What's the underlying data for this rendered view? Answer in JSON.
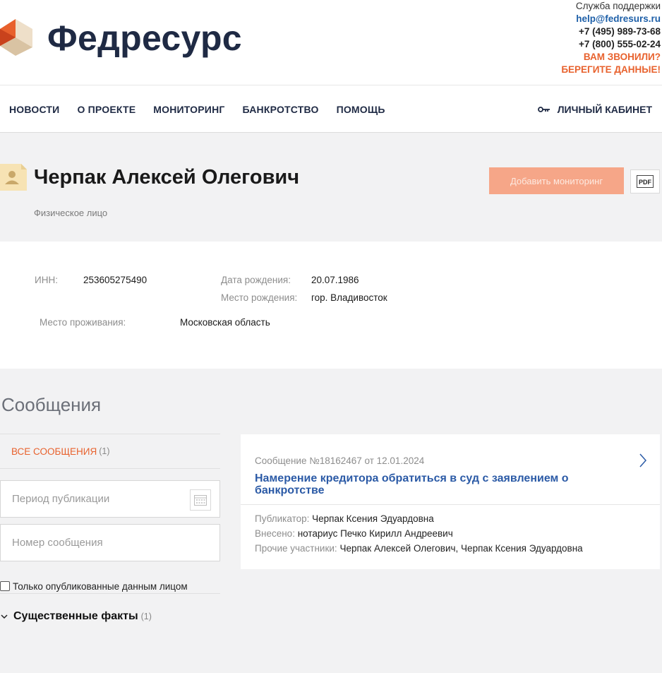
{
  "header": {
    "brand": "Федресурс",
    "support_label": "Служба поддержки",
    "support_email": "help@fedresurs.ru",
    "phone_1": "+7 (495) 989-73-68",
    "phone_2": "+7 (800) 555-02-24",
    "warning_1": "ВАМ ЗВОНИЛИ?",
    "warning_2": "БЕРЕГИТЕ ДАННЫЕ!"
  },
  "nav": {
    "items": [
      "НОВОСТИ",
      "О ПРОЕКТЕ",
      "МОНИТОРИНГ",
      "БАНКРОТСТВО",
      "ПОМОЩЬ"
    ],
    "cabinet": "ЛИЧНЫЙ КАБИНЕТ"
  },
  "person": {
    "name": "Черпак Алексей Олегович",
    "type": "Физическое лицо",
    "monitor_button": "Добавить мониторинг",
    "pdf_label": "PDF"
  },
  "details": {
    "inn_label": "ИНН:",
    "inn": "253605275490",
    "birth_date_label": "Дата рождения:",
    "birth_date": "20.07.1986",
    "birth_place_label": "Место рождения:",
    "birth_place": "гор. Владивосток",
    "residence_label": "Место проживания:",
    "residence": "Московская область"
  },
  "messages": {
    "title": "Сообщения",
    "all_label": "ВСЕ СООБЩЕНИЯ",
    "all_count": "(1)",
    "period_placeholder": "Период публикации",
    "number_placeholder": "Номер сообщения",
    "own_only_label": "Только опубликованные данным лицом",
    "facts_label": "Существенные факты",
    "facts_count": "(1)",
    "card": {
      "header": "Сообщение №18162467 от 12.01.2024",
      "subject": "Намерение кредитора обратиться в суд с заявлением о банкротстве",
      "publisher_label": "Публикатор:",
      "publisher": "Черпак Ксения Эдуардовна",
      "entered_label": "Внесено:",
      "entered": "нотариус Печко Кирилл Андреевич",
      "others_label": "Прочие участники:",
      "others": "Черпак Алексей Олегович, Черпак Ксения Эдуардовна"
    }
  },
  "colors": {
    "accent": "#e8622e",
    "brand_dark": "#1f2a44",
    "link_blue": "#2b5aa6",
    "button_bg": "#f6a688"
  }
}
